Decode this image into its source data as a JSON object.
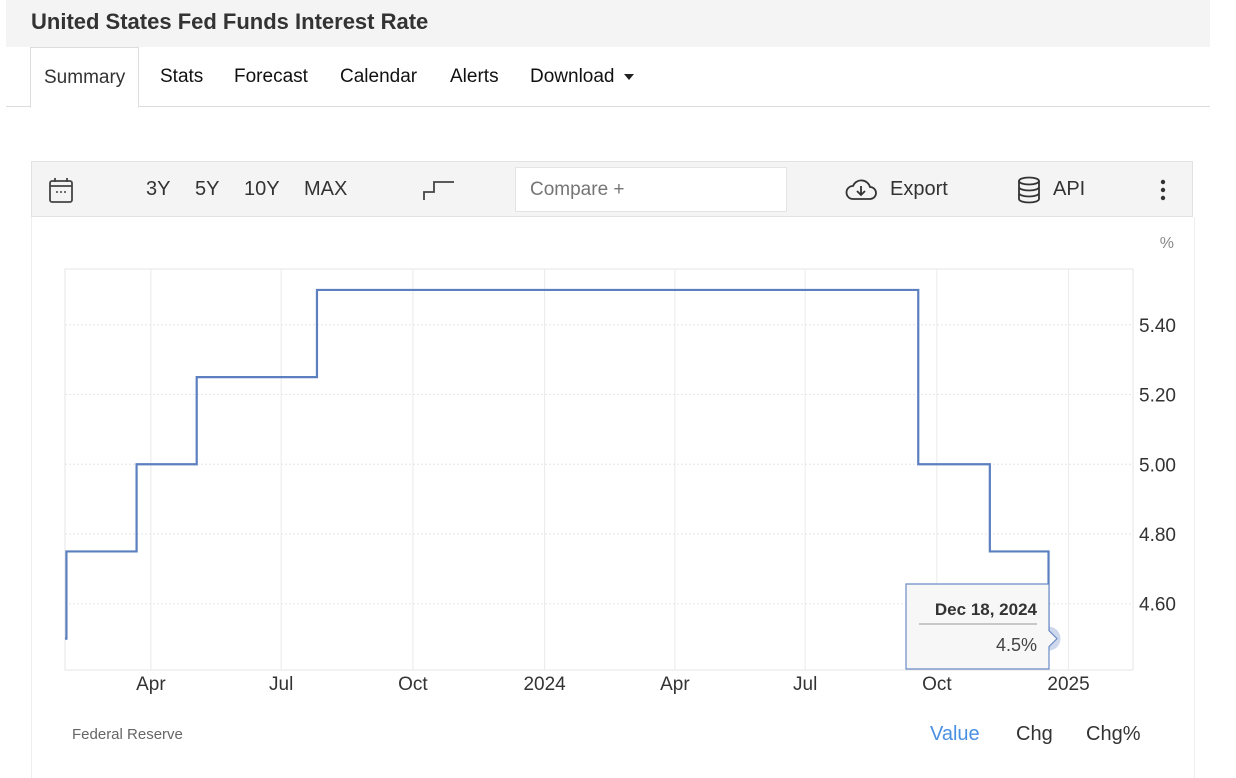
{
  "page": {
    "title": "United States Fed Funds Interest Rate"
  },
  "tabs": [
    {
      "label": "Summary",
      "active": true
    },
    {
      "label": "Stats"
    },
    {
      "label": "Forecast"
    },
    {
      "label": "Calendar"
    },
    {
      "label": "Alerts"
    },
    {
      "label": "Download"
    }
  ],
  "toolbar": {
    "calendar_icon": "calendar-icon",
    "ranges": [
      "3Y",
      "5Y",
      "10Y",
      "MAX"
    ],
    "chart_type_icon": "step-line-icon",
    "compare_placeholder": "Compare +",
    "export_label": "Export",
    "api_label": "API",
    "more_icon": "more-vertical-icon"
  },
  "footer": {
    "source": "Federal Reserve",
    "modes": [
      {
        "label": "Value",
        "active": true
      },
      {
        "label": "Chg"
      },
      {
        "label": "Chg%"
      }
    ],
    "active_color": "#4a90e2"
  },
  "chart_data": {
    "type": "line",
    "step": true,
    "unit": "%",
    "line_color": "#5b7fbf",
    "grid": true,
    "xlim": [
      "2023-01-31",
      "2025-02-15"
    ],
    "ylim": [
      4.41,
      5.56
    ],
    "x_ticks": [
      {
        "date": "2023-04-01",
        "label": "Apr"
      },
      {
        "date": "2023-07-01",
        "label": "Jul"
      },
      {
        "date": "2023-10-01",
        "label": "Oct"
      },
      {
        "date": "2024-01-01",
        "label": "2024"
      },
      {
        "date": "2024-04-01",
        "label": "Apr"
      },
      {
        "date": "2024-07-01",
        "label": "Jul"
      },
      {
        "date": "2024-10-01",
        "label": "Oct"
      },
      {
        "date": "2025-01-01",
        "label": "2025"
      }
    ],
    "y_ticks": [
      4.6,
      4.8,
      5.0,
      5.2,
      5.4
    ],
    "y_tick_labels": [
      "4.60",
      "4.80",
      "5.00",
      "5.20",
      "5.40"
    ],
    "points": [
      [
        "2023-01-31",
        4.5
      ],
      [
        "2023-02-01",
        4.75
      ],
      [
        "2023-03-22",
        5.0
      ],
      [
        "2023-05-03",
        5.25
      ],
      [
        "2023-07-26",
        5.5
      ],
      [
        "2024-09-18",
        5.0
      ],
      [
        "2024-11-07",
        4.75
      ],
      [
        "2024-12-18",
        4.5
      ]
    ],
    "tooltip": {
      "date": "Dec 18, 2024",
      "value": "4.5%"
    }
  }
}
